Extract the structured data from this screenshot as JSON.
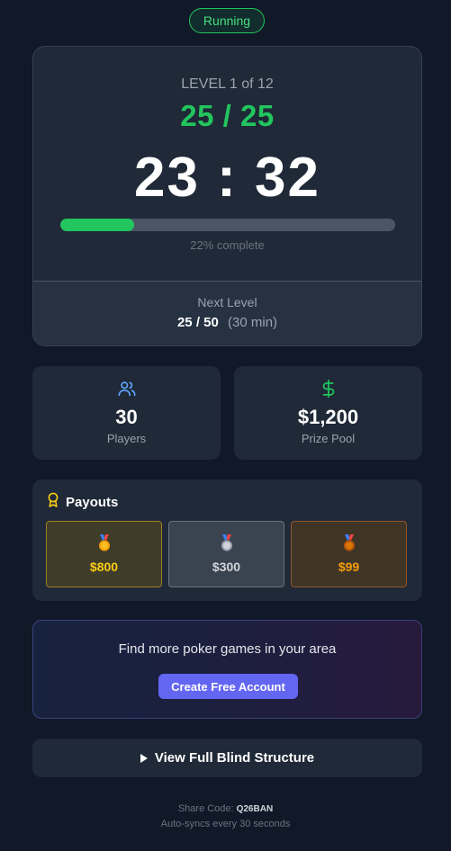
{
  "status": {
    "label": "Running",
    "color": "#22c55e"
  },
  "timer": {
    "level_label": "LEVEL 1 of 12",
    "blinds": "25 / 25",
    "clock": "23 : 32",
    "progress_percent": 22,
    "progress_text": "22% complete"
  },
  "next_level": {
    "label": "Next Level",
    "blinds": "25 / 50",
    "duration": "(30 min)"
  },
  "stats": {
    "players": {
      "value": "30",
      "label": "Players",
      "icon": "users-icon"
    },
    "prize_pool": {
      "value": "$1,200",
      "label": "Prize Pool",
      "icon": "dollar-icon"
    }
  },
  "payouts": {
    "title": "Payouts",
    "icon": "award-icon",
    "items": [
      {
        "place": "1",
        "amount": "$800",
        "medal": "gold-medal-icon"
      },
      {
        "place": "2",
        "amount": "$300",
        "medal": "silver-medal-icon"
      },
      {
        "place": "3",
        "amount": "$99",
        "medal": "bronze-medal-icon"
      }
    ]
  },
  "promo": {
    "text": "Find more poker games in your area",
    "button_label": "Create Free Account"
  },
  "structure": {
    "button_label": "View Full Blind Structure"
  },
  "footer": {
    "share_label": "Share Code:",
    "share_code": "Q26BAN",
    "sync_text": "Auto-syncs every 30 seconds"
  },
  "colors": {
    "background": "#111827",
    "card": "#1f2937",
    "accent_green": "#22c55e",
    "accent_indigo": "#6366f1"
  }
}
